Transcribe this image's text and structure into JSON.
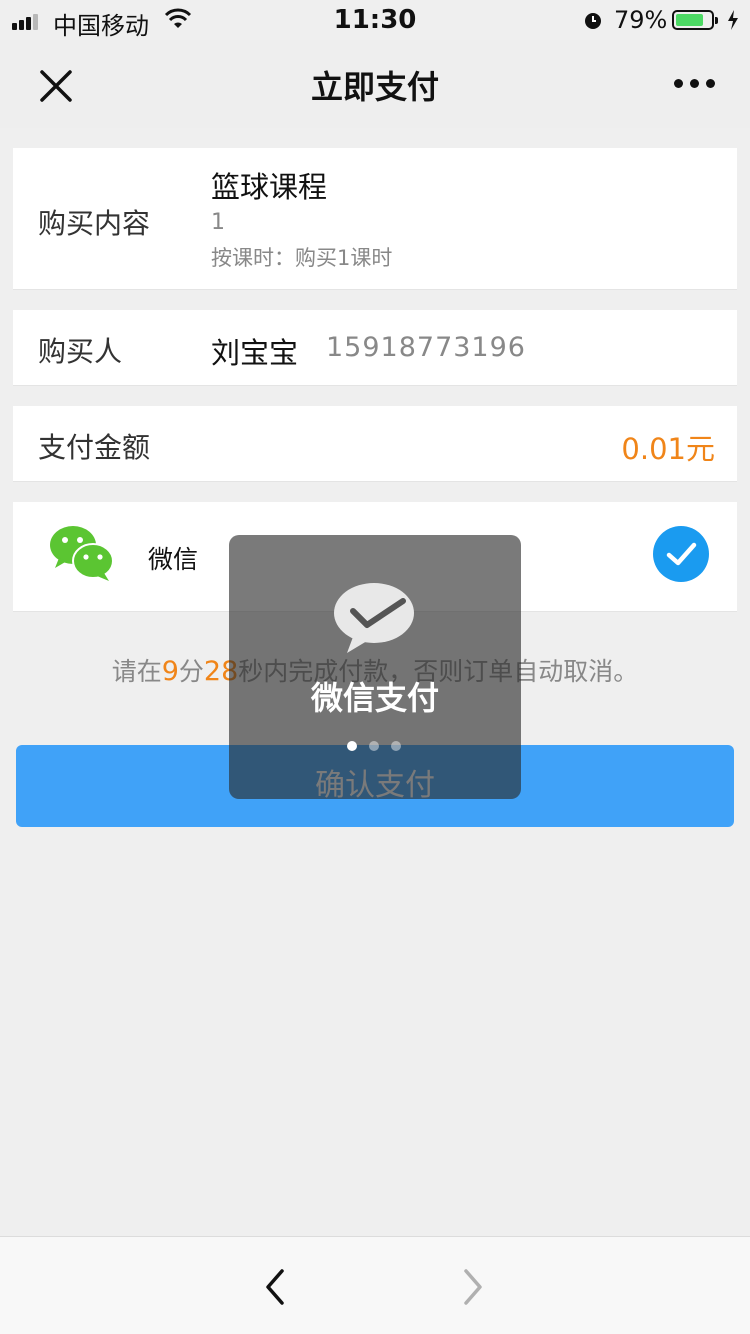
{
  "status_bar": {
    "carrier": "中国移动",
    "time": "11:30",
    "battery": "79%",
    "battery_level": 0.79
  },
  "nav": {
    "title": "立即支付",
    "close_icon": "close-icon",
    "more_icon": "more-dots-icon"
  },
  "order": {
    "content_label": "购买内容",
    "course_name": "篮球课程",
    "quantity": "1",
    "description": "按课时：购买1课时",
    "buyer_label": "购买人",
    "buyer_name": "刘宝宝",
    "buyer_phone": "15918773196",
    "amount_label": "支付金额",
    "amount": "0.01元"
  },
  "payment": {
    "method": "微信",
    "icon": "wechat-icon",
    "selected": true
  },
  "countdown": {
    "prefix": "请在",
    "minutes": "9",
    "minutes_unit": "分",
    "seconds": "28",
    "suffix": "秒内完成付款，否则订单自动取消。"
  },
  "confirm_button": "确认支付",
  "toast": {
    "text": "微信支付",
    "icon": "wechat-pay-icon"
  },
  "toolbar": {
    "back_icon": "chevron-left-icon",
    "forward_icon": "chevron-right-icon"
  },
  "colors": {
    "accent": "#40a2f8",
    "price": "#f08519",
    "wechat_green": "#5bc532",
    "check_blue": "#1a9bf0"
  }
}
